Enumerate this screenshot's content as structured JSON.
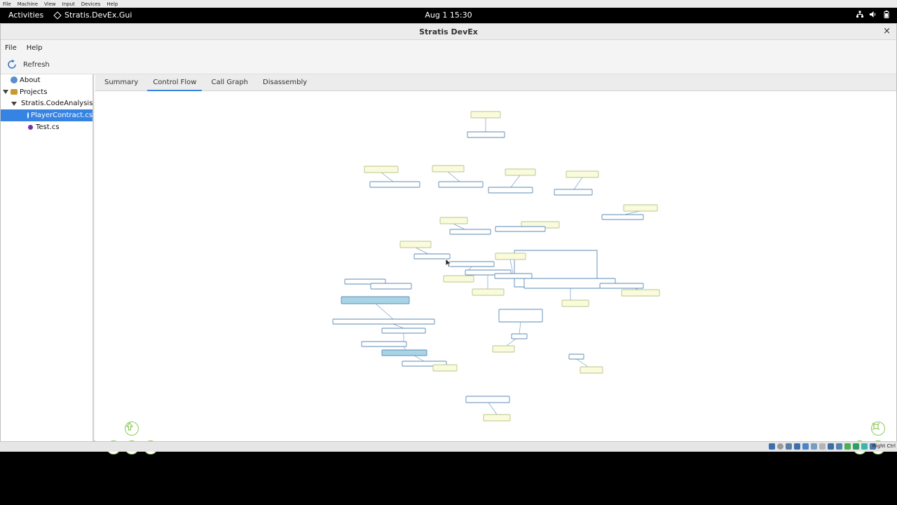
{
  "host_menu": [
    "File",
    "Machine",
    "View",
    "Input",
    "Devices",
    "Help"
  ],
  "topbar": {
    "activities": "Activities",
    "app_name": "Stratis.DevEx.Gui",
    "clock": "Aug 1  15:30"
  },
  "window": {
    "title": "Stratis DevEx",
    "close_glyph": "×"
  },
  "menubar": {
    "file": "File",
    "help": "Help"
  },
  "toolbar": {
    "refresh_label": "Refresh"
  },
  "sidebar": {
    "items": [
      {
        "label": "About"
      },
      {
        "label": "Projects"
      },
      {
        "label": "Stratis.CodeAnalysis.Cs"
      },
      {
        "label": "PlayerContract.cs",
        "selected": true
      },
      {
        "label": "Test.cs"
      }
    ]
  },
  "tabs": [
    {
      "label": "Summary"
    },
    {
      "label": "Control Flow",
      "active": true
    },
    {
      "label": "Call Graph"
    },
    {
      "label": "Disassembly"
    }
  ],
  "graph": {
    "node_fill_yellow": "#fafbdc",
    "node_fill_white": "#ffffff",
    "node_fill_blue": "#a8d4e6",
    "node_stroke": "#5b8ab5",
    "edge_color": "#7aa3c2"
  },
  "statusbar": {
    "host_key": "Right Ctrl"
  },
  "icons": {
    "nav_up": "arrow-up-icon",
    "nav_down": "arrow-down-icon",
    "nav_left": "arrow-left-icon",
    "nav_right": "arrow-right-icon",
    "fit": "fit-view-icon",
    "zoom_out": "zoom-out-icon",
    "zoom_in": "zoom-in-icon"
  },
  "accent_color": "#3584e4"
}
